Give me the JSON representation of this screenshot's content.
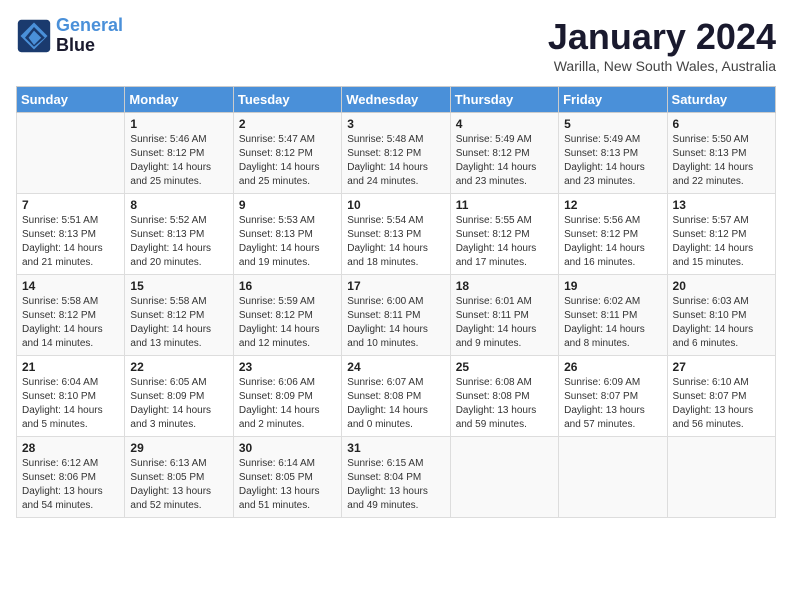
{
  "header": {
    "logo_line1": "General",
    "logo_line2": "Blue",
    "month": "January 2024",
    "location": "Warilla, New South Wales, Australia"
  },
  "days_of_week": [
    "Sunday",
    "Monday",
    "Tuesday",
    "Wednesday",
    "Thursday",
    "Friday",
    "Saturday"
  ],
  "weeks": [
    [
      {
        "day": "",
        "info": ""
      },
      {
        "day": "1",
        "info": "Sunrise: 5:46 AM\nSunset: 8:12 PM\nDaylight: 14 hours\nand 25 minutes."
      },
      {
        "day": "2",
        "info": "Sunrise: 5:47 AM\nSunset: 8:12 PM\nDaylight: 14 hours\nand 25 minutes."
      },
      {
        "day": "3",
        "info": "Sunrise: 5:48 AM\nSunset: 8:12 PM\nDaylight: 14 hours\nand 24 minutes."
      },
      {
        "day": "4",
        "info": "Sunrise: 5:49 AM\nSunset: 8:12 PM\nDaylight: 14 hours\nand 23 minutes."
      },
      {
        "day": "5",
        "info": "Sunrise: 5:49 AM\nSunset: 8:13 PM\nDaylight: 14 hours\nand 23 minutes."
      },
      {
        "day": "6",
        "info": "Sunrise: 5:50 AM\nSunset: 8:13 PM\nDaylight: 14 hours\nand 22 minutes."
      }
    ],
    [
      {
        "day": "7",
        "info": "Sunrise: 5:51 AM\nSunset: 8:13 PM\nDaylight: 14 hours\nand 21 minutes."
      },
      {
        "day": "8",
        "info": "Sunrise: 5:52 AM\nSunset: 8:13 PM\nDaylight: 14 hours\nand 20 minutes."
      },
      {
        "day": "9",
        "info": "Sunrise: 5:53 AM\nSunset: 8:13 PM\nDaylight: 14 hours\nand 19 minutes."
      },
      {
        "day": "10",
        "info": "Sunrise: 5:54 AM\nSunset: 8:13 PM\nDaylight: 14 hours\nand 18 minutes."
      },
      {
        "day": "11",
        "info": "Sunrise: 5:55 AM\nSunset: 8:12 PM\nDaylight: 14 hours\nand 17 minutes."
      },
      {
        "day": "12",
        "info": "Sunrise: 5:56 AM\nSunset: 8:12 PM\nDaylight: 14 hours\nand 16 minutes."
      },
      {
        "day": "13",
        "info": "Sunrise: 5:57 AM\nSunset: 8:12 PM\nDaylight: 14 hours\nand 15 minutes."
      }
    ],
    [
      {
        "day": "14",
        "info": "Sunrise: 5:58 AM\nSunset: 8:12 PM\nDaylight: 14 hours\nand 14 minutes."
      },
      {
        "day": "15",
        "info": "Sunrise: 5:58 AM\nSunset: 8:12 PM\nDaylight: 14 hours\nand 13 minutes."
      },
      {
        "day": "16",
        "info": "Sunrise: 5:59 AM\nSunset: 8:12 PM\nDaylight: 14 hours\nand 12 minutes."
      },
      {
        "day": "17",
        "info": "Sunrise: 6:00 AM\nSunset: 8:11 PM\nDaylight: 14 hours\nand 10 minutes."
      },
      {
        "day": "18",
        "info": "Sunrise: 6:01 AM\nSunset: 8:11 PM\nDaylight: 14 hours\nand 9 minutes."
      },
      {
        "day": "19",
        "info": "Sunrise: 6:02 AM\nSunset: 8:11 PM\nDaylight: 14 hours\nand 8 minutes."
      },
      {
        "day": "20",
        "info": "Sunrise: 6:03 AM\nSunset: 8:10 PM\nDaylight: 14 hours\nand 6 minutes."
      }
    ],
    [
      {
        "day": "21",
        "info": "Sunrise: 6:04 AM\nSunset: 8:10 PM\nDaylight: 14 hours\nand 5 minutes."
      },
      {
        "day": "22",
        "info": "Sunrise: 6:05 AM\nSunset: 8:09 PM\nDaylight: 14 hours\nand 3 minutes."
      },
      {
        "day": "23",
        "info": "Sunrise: 6:06 AM\nSunset: 8:09 PM\nDaylight: 14 hours\nand 2 minutes."
      },
      {
        "day": "24",
        "info": "Sunrise: 6:07 AM\nSunset: 8:08 PM\nDaylight: 14 hours\nand 0 minutes."
      },
      {
        "day": "25",
        "info": "Sunrise: 6:08 AM\nSunset: 8:08 PM\nDaylight: 13 hours\nand 59 minutes."
      },
      {
        "day": "26",
        "info": "Sunrise: 6:09 AM\nSunset: 8:07 PM\nDaylight: 13 hours\nand 57 minutes."
      },
      {
        "day": "27",
        "info": "Sunrise: 6:10 AM\nSunset: 8:07 PM\nDaylight: 13 hours\nand 56 minutes."
      }
    ],
    [
      {
        "day": "28",
        "info": "Sunrise: 6:12 AM\nSunset: 8:06 PM\nDaylight: 13 hours\nand 54 minutes."
      },
      {
        "day": "29",
        "info": "Sunrise: 6:13 AM\nSunset: 8:05 PM\nDaylight: 13 hours\nand 52 minutes."
      },
      {
        "day": "30",
        "info": "Sunrise: 6:14 AM\nSunset: 8:05 PM\nDaylight: 13 hours\nand 51 minutes."
      },
      {
        "day": "31",
        "info": "Sunrise: 6:15 AM\nSunset: 8:04 PM\nDaylight: 13 hours\nand 49 minutes."
      },
      {
        "day": "",
        "info": ""
      },
      {
        "day": "",
        "info": ""
      },
      {
        "day": "",
        "info": ""
      }
    ]
  ]
}
